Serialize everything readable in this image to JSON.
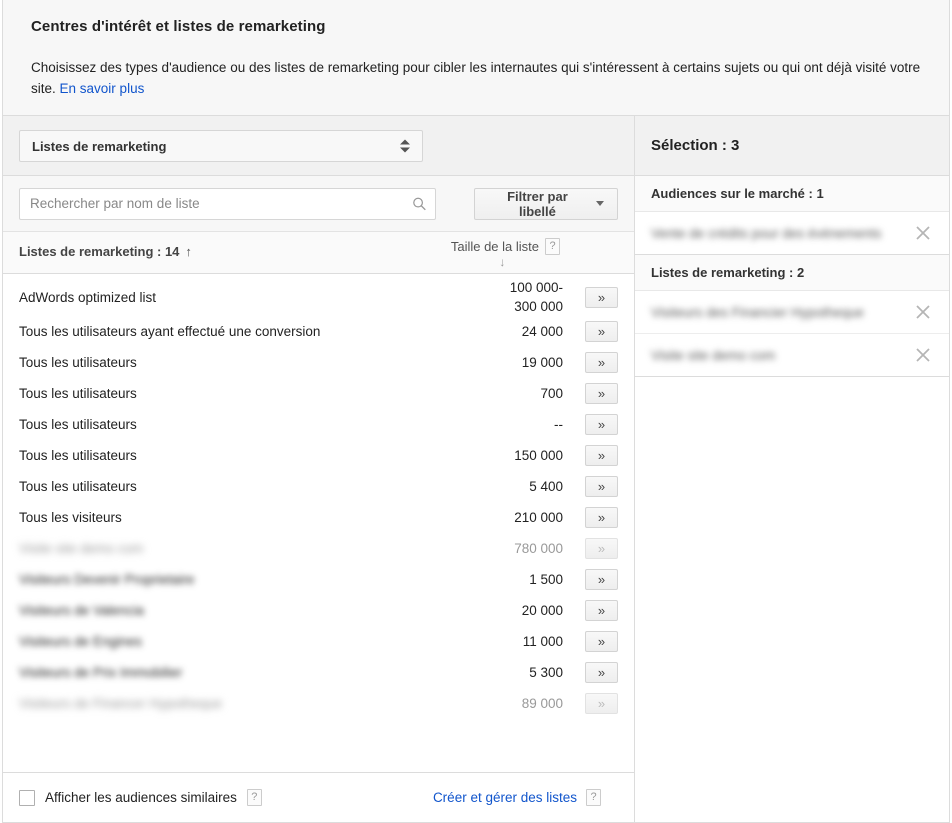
{
  "header": {
    "title": "Centres d'intérêt et listes de remarketing",
    "description": "Choisissez des types d'audience ou des listes de remarketing pour cibler les internautes qui s'intéressent à certains sujets ou qui ont déjà visité votre site.",
    "learn_more": "En savoir plus"
  },
  "selector": {
    "value": "Listes de remarketing"
  },
  "search": {
    "placeholder": "Rechercher par nom de liste",
    "value": "",
    "icon": "search-icon"
  },
  "filter_button": {
    "label": "Filtrer par libellé",
    "icon": "chevron-down-icon"
  },
  "table": {
    "col_name": "Listes de remarketing : 14",
    "col_name_sort": "↑",
    "col_size": "Taille de la liste",
    "col_size_sort": "↓",
    "help": "?",
    "add_button": "»",
    "rows": [
      {
        "name": "AdWords optimized list",
        "size": "100 000-\n300 000",
        "muted": false,
        "blurred": false
      },
      {
        "name": "Tous les utilisateurs ayant effectué une conversion",
        "size": "24 000",
        "muted": false,
        "blurred": false
      },
      {
        "name": "Tous les utilisateurs",
        "size": "19 000",
        "muted": false,
        "blurred": false
      },
      {
        "name": "Tous les utilisateurs",
        "size": "700",
        "muted": false,
        "blurred": false
      },
      {
        "name": "Tous les utilisateurs",
        "size": "--",
        "muted": false,
        "blurred": false
      },
      {
        "name": "Tous les utilisateurs",
        "size": "150 000",
        "muted": false,
        "blurred": false
      },
      {
        "name": "Tous les utilisateurs",
        "size": "5 400",
        "muted": false,
        "blurred": false
      },
      {
        "name": "Tous les visiteurs",
        "size": "210 000",
        "muted": false,
        "blurred": false
      },
      {
        "name": "Visite site demo com",
        "size": "780 000",
        "muted": true,
        "blurred": true
      },
      {
        "name": "Visiteurs Devenir Proprietaire",
        "size": "1 500",
        "muted": false,
        "blurred": true
      },
      {
        "name": "Visiteurs de Valencia",
        "size": "20 000",
        "muted": false,
        "blurred": true
      },
      {
        "name": "Visiteurs de Engines",
        "size": "11 000",
        "muted": false,
        "blurred": true
      },
      {
        "name": "Visiteurs de Prix Immobilier",
        "size": "5 300",
        "muted": false,
        "blurred": true
      },
      {
        "name": "Visiteurs de Financer Hypotheque",
        "size": "89 000",
        "muted": true,
        "blurred": true
      }
    ]
  },
  "footer": {
    "similar_audiences_label": "Afficher les audiences similaires",
    "similar_audiences_checked": false,
    "similar_help": "?",
    "manage_lists_link": "Créer et gérer des listes",
    "manage_help": "?"
  },
  "selection": {
    "title": "Sélection : 3",
    "remove_icon": "close-icon",
    "groups": [
      {
        "label": "Audiences sur le marché : 1",
        "items": [
          {
            "name": "Vente de crédits pour des évènements"
          }
        ]
      },
      {
        "label": "Listes de remarketing : 2",
        "items": [
          {
            "name": "Visiteurs des Financier Hypotheque"
          },
          {
            "name": "Visite site demo com"
          }
        ]
      }
    ]
  },
  "colors": {
    "link": "#1155cc",
    "panel_bg": "#f1f1f1",
    "border": "#dcdcdc"
  }
}
